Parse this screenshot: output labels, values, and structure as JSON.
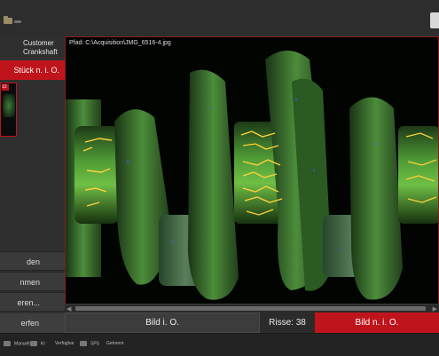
{
  "sidebar": {
    "customer": "Customer",
    "part": "Crankshaft",
    "status": "Stück n. i. O.",
    "thumb_label": "12",
    "buttons": [
      "den",
      "nmen",
      "eren...",
      "erfen"
    ]
  },
  "image": {
    "path_label": "Pfad: C:\\Acquisition\\JMG_6516-4.jpg"
  },
  "bottom": {
    "btn_ok": "Bild i. O.",
    "cracks": "Risse: 38",
    "btn_nok": "Bild n. i. O."
  },
  "statusbar": {
    "items": [
      "Manuell",
      "KI",
      "Verfügbar",
      "SPS",
      "Getrennt"
    ]
  },
  "colors": {
    "accent_red": "#c0141c",
    "crack_yellow": "#ffd23a",
    "fluorescent_green": "#5fbf3c"
  }
}
